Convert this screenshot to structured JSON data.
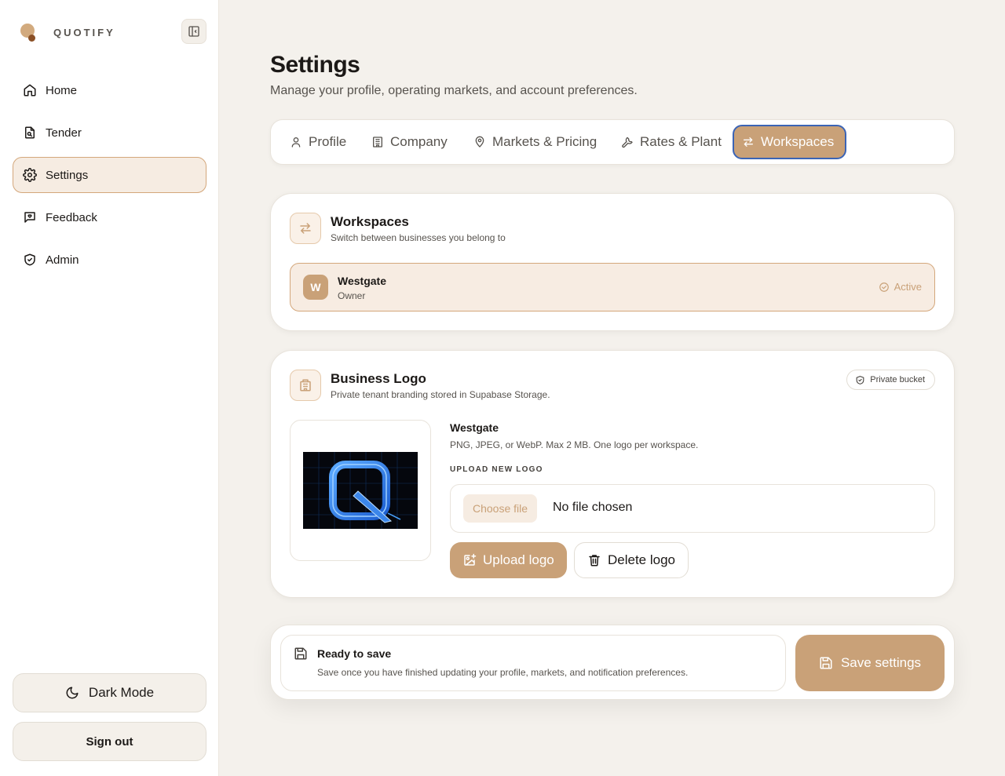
{
  "brand": {
    "name": "QUOTIFY"
  },
  "sidebar": {
    "items": [
      {
        "label": "Home",
        "icon": "home-icon"
      },
      {
        "label": "Tender",
        "icon": "document-icon"
      },
      {
        "label": "Settings",
        "icon": "gear-icon",
        "active": true
      },
      {
        "label": "Feedback",
        "icon": "message-icon"
      },
      {
        "label": "Admin",
        "icon": "shield-icon"
      }
    ],
    "dark_mode_label": "Dark Mode",
    "sign_out_label": "Sign out"
  },
  "page": {
    "title": "Settings",
    "subtitle": "Manage your profile, operating markets, and account preferences."
  },
  "tabs": [
    {
      "label": "Profile",
      "icon": "user-icon"
    },
    {
      "label": "Company",
      "icon": "building-icon"
    },
    {
      "label": "Markets & Pricing",
      "icon": "map-pin-icon"
    },
    {
      "label": "Rates & Plant",
      "icon": "wrench-icon"
    },
    {
      "label": "Workspaces",
      "icon": "swap-icon",
      "active": true
    }
  ],
  "workspaces": {
    "title": "Workspaces",
    "subtitle": "Switch between businesses you belong to",
    "items": [
      {
        "initial": "W",
        "name": "Westgate",
        "role": "Owner",
        "status": "Active"
      }
    ]
  },
  "business_logo": {
    "title": "Business Logo",
    "subtitle": "Private tenant branding stored in Supabase Storage.",
    "badge": "Private bucket",
    "workspace_name": "Westgate",
    "hint": "PNG, JPEG, or WebP. Max 2 MB. One logo per workspace.",
    "upload_label": "UPLOAD NEW LOGO",
    "choose_file_label": "Choose file",
    "file_status": "No file chosen",
    "upload_button": "Upload logo",
    "delete_button": "Delete logo"
  },
  "save_bar": {
    "title": "Ready to save",
    "description": "Save once you have finished updating your profile, markets, and notification preferences.",
    "button": "Save settings"
  },
  "colors": {
    "accent": "#c9a178",
    "accent_soft": "#f6ece2",
    "background": "#f4f1ec",
    "focus_ring": "#3b64b5"
  }
}
